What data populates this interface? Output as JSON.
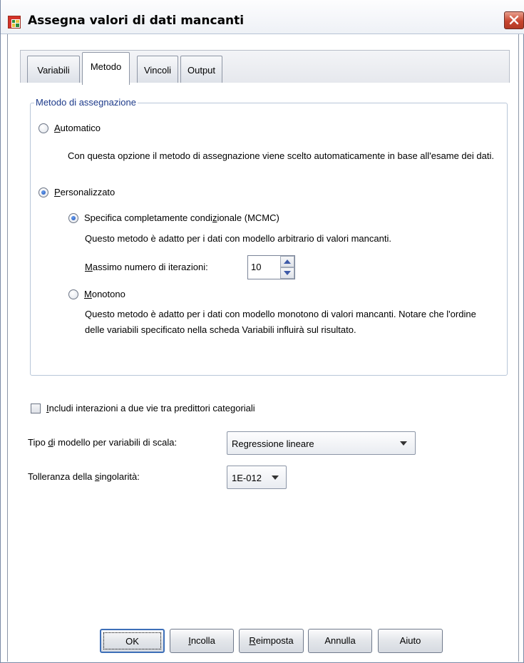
{
  "window": {
    "title": "Assegna valori di dati mancanti",
    "app_icon": "table-grid-icon",
    "close_icon": "close-icon"
  },
  "tabs": [
    {
      "label": "Variabili",
      "active": false
    },
    {
      "label": "Metodo",
      "active": true
    },
    {
      "label": "Vincoli",
      "active": false
    },
    {
      "label": "Output",
      "active": false
    }
  ],
  "method_group": {
    "legend": "Metodo di assegnazione",
    "automatic": {
      "label_first": "A",
      "label_rest": "utomatico",
      "selected": false,
      "description": "Con questa opzione il metodo di assegnazione viene scelto automaticamente in base all'esame dei dati."
    },
    "custom": {
      "label_first": "P",
      "label_rest": "ersonalizzato",
      "selected": true,
      "fcs": {
        "label_pre": "Specifica completamente condi",
        "label_mnemonic": "z",
        "label_post": "ionale (MCMC)",
        "selected": true,
        "description": "Questo metodo è adatto per i dati con modello arbitrario di valori mancanti.",
        "iterations_label_first": "M",
        "iterations_label_rest": "assimo numero di iterazioni:",
        "iterations_value": "10"
      },
      "monotone": {
        "label_first": "M",
        "label_rest": "onotono",
        "selected": false,
        "description": "Questo metodo è adatto per i dati con modello monotono di valori mancanti. Notare che l'ordine delle variabili specificato nella scheda Variabili influirà sul risultato."
      }
    }
  },
  "interactions": {
    "label_first": "I",
    "label_rest": "ncludi interazioni a due vie tra predittori categoriali",
    "checked": false
  },
  "scale_model": {
    "label_pre": "Tipo ",
    "label_mnemonic": "d",
    "label_post": "i modello per variabili di scala:",
    "value": "Regressione lineare"
  },
  "tolerance": {
    "label_pre": "Tolleranza della ",
    "label_mnemonic": "s",
    "label_post": "ingolarità:",
    "value": "1E-012"
  },
  "buttons": {
    "ok": "OK",
    "paste_first": "I",
    "paste_rest": "ncolla",
    "reset_first": "R",
    "reset_rest": "eimposta",
    "cancel": "Annulla",
    "help": "Aiuto"
  },
  "colors": {
    "legend_text": "#1c3a8a",
    "close_button": "#c8452f",
    "default_button_border": "#3d6fb8"
  }
}
